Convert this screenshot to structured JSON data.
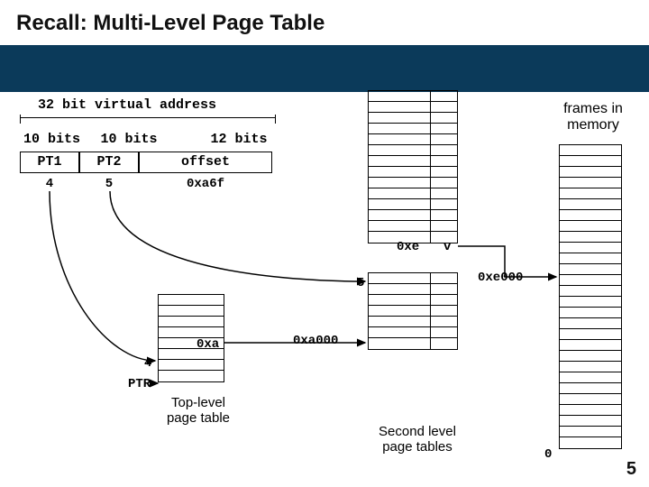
{
  "title": "Recall: Multi-Level Page Table",
  "va_title": "32 bit virtual address",
  "bits": {
    "pt1": "10 bits",
    "pt2": "10 bits",
    "off": "12 bits"
  },
  "fields": {
    "pt1": "PT1",
    "pt2": "PT2",
    "off": "offset"
  },
  "values": {
    "pt1": "4",
    "pt2": "5",
    "off": "0xa6f"
  },
  "top_table_label": "Top-level\npage table",
  "second_table_label": "Second level\npage tables",
  "mem_label": "frames in\nmemory",
  "ptr_label": "PTR",
  "top_entry_idx_label": "4",
  "top_entry_val": "0xa",
  "sec_entry_idx_label": "5",
  "sec_entry_val": "0xe",
  "sec_entry_valid": "v",
  "sec_arrow_val": "0xa000",
  "mem_arrow_val": "0xe000",
  "mem_zero": "0",
  "slide_num": "5"
}
